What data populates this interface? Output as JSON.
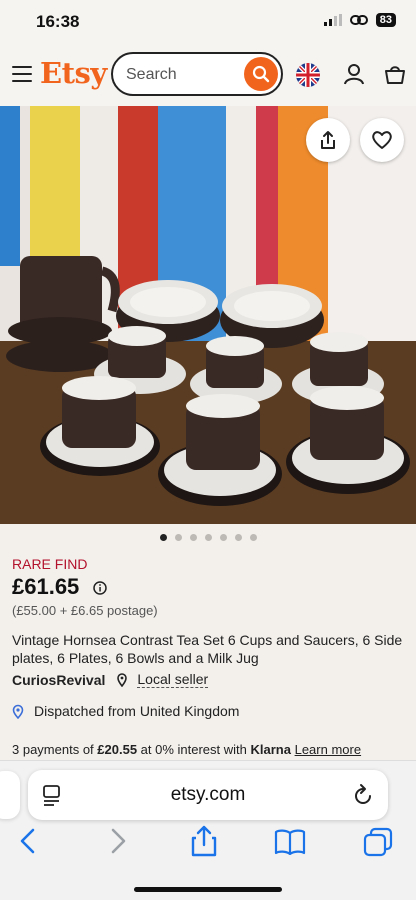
{
  "status": {
    "time": "16:38",
    "battery": "83"
  },
  "header": {
    "logo": "Etsy",
    "search_placeholder": "Search"
  },
  "hero": {
    "image_alt": "Vintage Hornsea Contrast tea set on striped background",
    "image_count": 7,
    "active_index": 0
  },
  "listing": {
    "badge": "RARE FIND",
    "price": "£61.65",
    "price_breakdown": "(£55.00 + £6.65 postage)",
    "title": "Vintage Hornsea Contrast Tea Set 6 Cups and Saucers, 6 Side plates, 6 Plates, 6 Bowls and a Milk Jug",
    "shop_name": "CuriosRevival",
    "local_seller": "Local seller",
    "dispatch": "Dispatched from United Kingdom",
    "klarna_prefix": "3 payments of ",
    "klarna_amount": "£20.55",
    "klarna_middle": " at 0% interest with ",
    "klarna_brand": "Klarna",
    "klarna_link": "Learn more"
  },
  "browser": {
    "url": "etsy.com"
  },
  "colors": {
    "accent": "#f1641e",
    "rare": "#b3122c",
    "ios_blue": "#1a73e8"
  }
}
